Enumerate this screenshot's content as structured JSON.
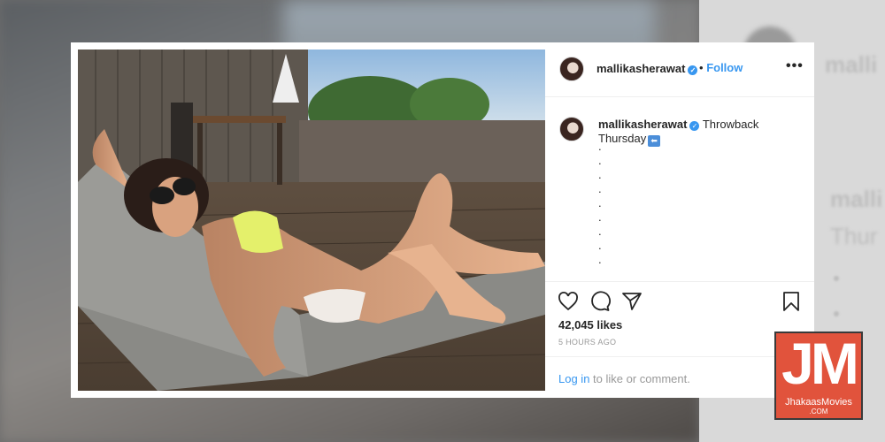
{
  "post": {
    "username": "mallikasherawat",
    "verified_mark": "✓",
    "follow_label": "Follow",
    "separator": "•",
    "more_label": "•••",
    "caption": "Throwback Thursday",
    "caption_emoji": "⬅",
    "caption_dots": [
      ".",
      ".",
      ".",
      ".",
      ".",
      ".",
      ".",
      ".",
      "."
    ],
    "likes": "42,045 likes",
    "timestamp": "5 HOURS AGO",
    "login_link": "Log in",
    "login_suffix": " to like or comment."
  },
  "watermark": {
    "mark": "JM",
    "name": "JhakaasMovies",
    "tld": ".COM"
  },
  "icons": {
    "like": "heart-icon",
    "comment": "comment-icon",
    "share": "share-icon",
    "save": "bookmark-icon"
  },
  "colors": {
    "link": "#3897f0",
    "text": "#262626",
    "muted": "#999999",
    "watermark_bg": "#e1533c"
  }
}
